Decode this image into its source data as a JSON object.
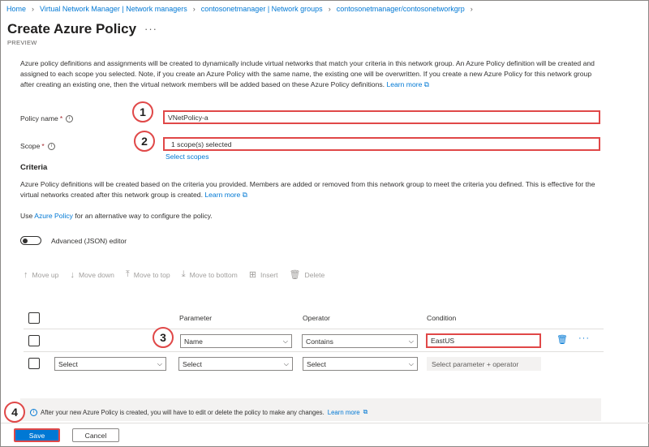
{
  "breadcrumb": [
    "Home",
    "Virtual Network Manager | Network managers",
    "contosonetmanager | Network groups",
    "contosonetmanager/contosonetworkgrp"
  ],
  "header": {
    "title": "Create Azure Policy",
    "more": "···",
    "subtitle": "PREVIEW"
  },
  "description": {
    "text": "Azure policy definitions and assignments will be created to dynamically include virtual networks that match your criteria in this network group. An Azure Policy definition will be created and assigned to each scope you selected. Note, if you create an Azure Policy with the same name, the existing one will be overwritten. If you create a new Azure Policy for this network group after creating an existing one, then the virtual network members will be added based on these Azure Policy definitions.",
    "learn_more": "Learn more"
  },
  "form": {
    "policy_name_label": "Policy name",
    "policy_name_value": "VNetPolicy-a",
    "scope_label": "Scope",
    "scope_value": "1 scope(s) selected",
    "select_scopes": "Select scopes"
  },
  "criteria": {
    "heading": "Criteria",
    "text": "Azure Policy definitions will be created based on the criteria you provided. Members are added or removed from this network group to meet the criteria you defined. This is effective for the virtual networks created after this network group is created.",
    "learn_more": "Learn more",
    "alt_prefix": "Use",
    "alt_link": "Azure Policy",
    "alt_suffix": "for an alternative way to configure the policy.",
    "toggle_label": "Advanced (JSON) editor"
  },
  "toolbar": [
    "Move up",
    "Move down",
    "Move to top",
    "Move to bottom",
    "Insert",
    "Delete"
  ],
  "table": {
    "headers": [
      "Parameter",
      "Operator",
      "Condition"
    ],
    "row1": {
      "parameter": "Name",
      "operator": "Contains",
      "condition": "EastUS"
    },
    "row2": {
      "group": "Select",
      "parameter": "Select",
      "operator": "Select",
      "condition_placeholder": "Select parameter + operator"
    }
  },
  "info": {
    "text": "After your new Azure Policy is created, you will have to edit or delete the policy to make any changes.",
    "learn_more": "Learn more"
  },
  "buttons": {
    "save": "Save",
    "cancel": "Cancel"
  },
  "callouts": [
    "1",
    "2",
    "3",
    "4"
  ],
  "colors": {
    "accent": "#0078d4",
    "highlight": "#e04848"
  }
}
